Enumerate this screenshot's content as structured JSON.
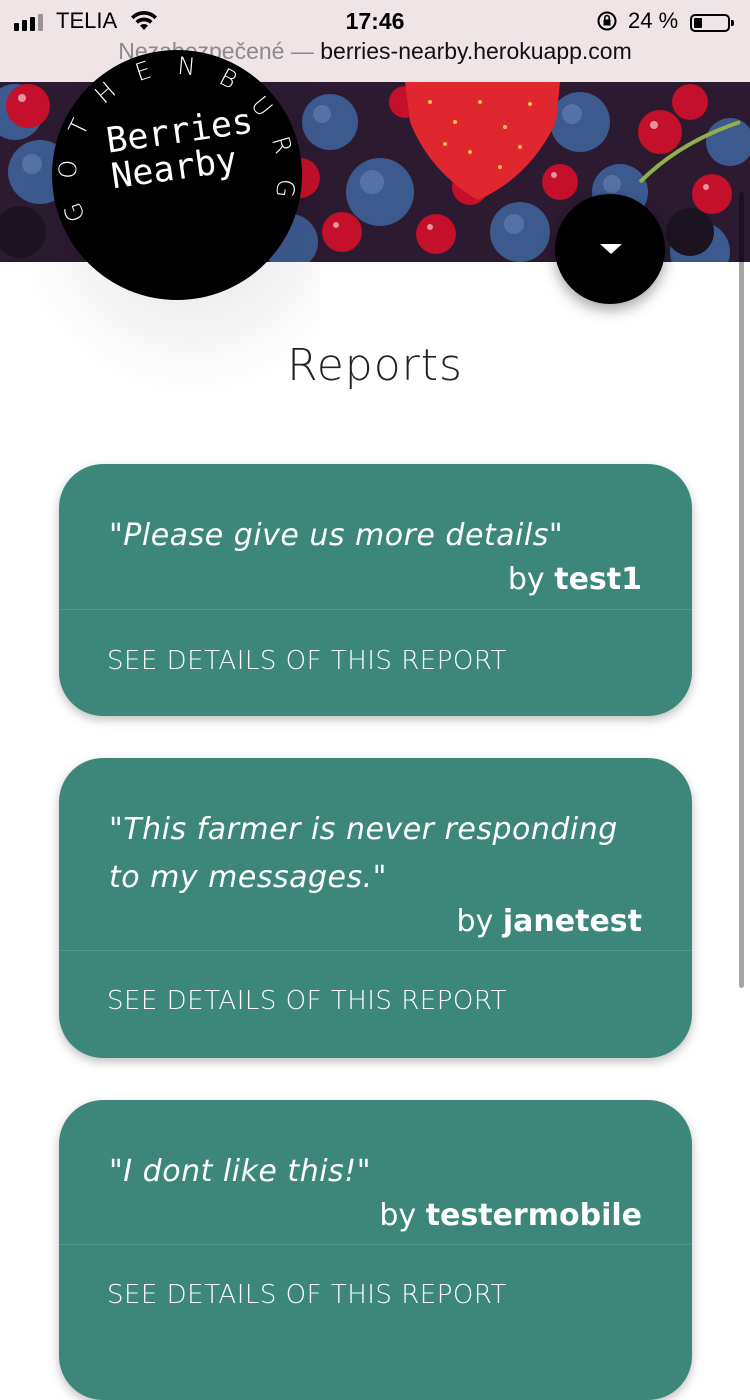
{
  "status": {
    "carrier": "TELIA",
    "time": "17:46",
    "battery": "24 %",
    "url_insecure": "Nezabezpečené —",
    "url_host": "berries-nearby.herokuapp.com"
  },
  "logo": {
    "title_line1": "Berries",
    "title_line2": "Nearby",
    "city_letters": [
      "G",
      "O",
      "T",
      "H",
      "E",
      "N",
      "B",
      "U",
      "R",
      "G"
    ]
  },
  "page": {
    "title": "Reports"
  },
  "reports": [
    {
      "quote": "\"Please give us more details\"",
      "by_label": "by",
      "user": "test1",
      "link": "SEE DETAILS OF THIS REPORT"
    },
    {
      "quote": "\"This farmer is never responding to my messages.\"",
      "by_label": "by",
      "user": "janetest",
      "link": "SEE DETAILS OF THIS REPORT"
    },
    {
      "quote": "\"I dont like this!\"",
      "by_label": "by",
      "user": "testermobile",
      "link": "SEE DETAILS OF THIS REPORT"
    }
  ],
  "icons": {
    "menu": "caret-down-icon",
    "wifi": "wifi-icon",
    "signal": "signal-icon",
    "battery": "battery-icon",
    "orientation_lock": "orientation-lock-icon"
  },
  "colors": {
    "card": "#3d877a",
    "logo_bg": "#000000",
    "status_bg": "#efe4e6"
  }
}
